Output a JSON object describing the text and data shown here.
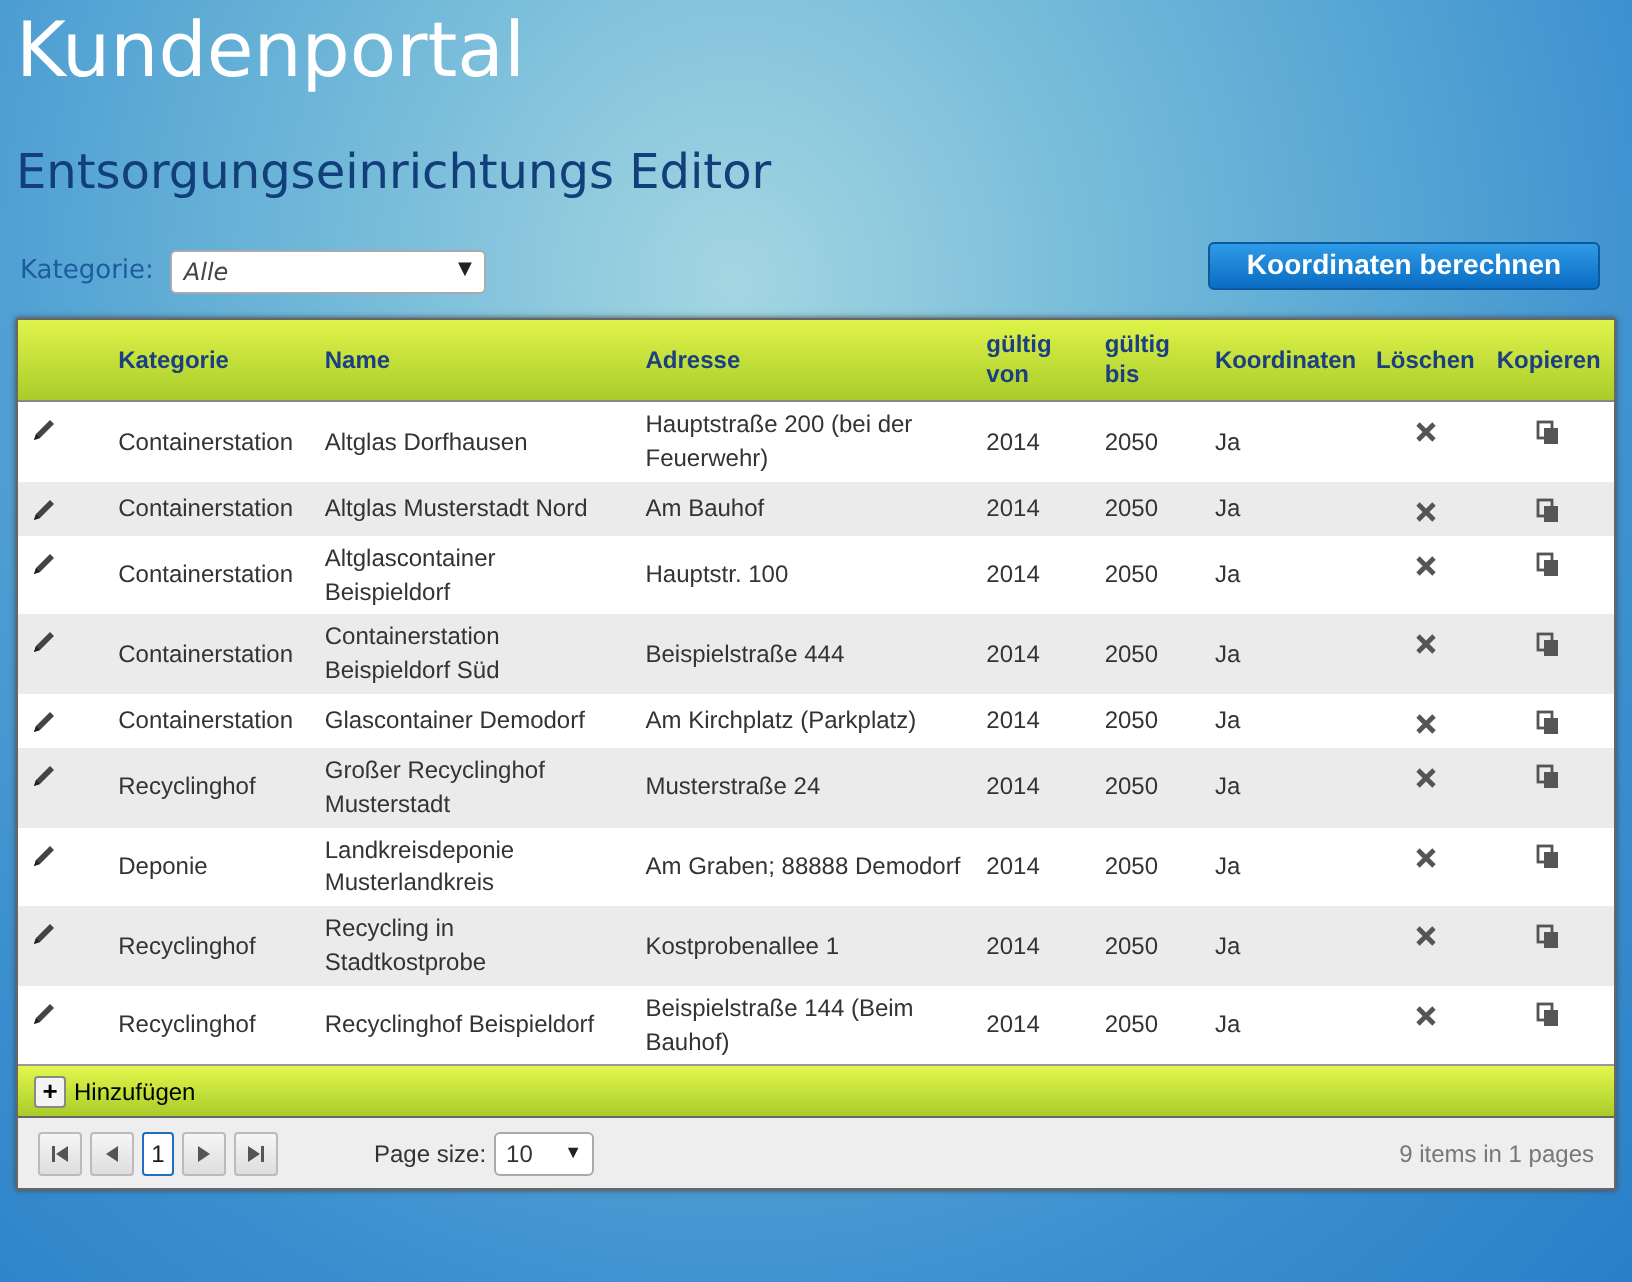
{
  "header": {
    "title": "Kundenportal",
    "subtitle": "Entsorgungseinrichtungs Editor"
  },
  "filter": {
    "label": "Kategorie:",
    "value": "Alle",
    "caret": "▼"
  },
  "action_button": "Koordinaten berechnen",
  "table": {
    "columns": [
      "Kategorie",
      "Name",
      "Adresse",
      "gültig von",
      "gültig bis",
      "Koordinaten",
      "Löschen",
      "Kopieren"
    ],
    "rows": [
      {
        "kategorie": "Containerstation",
        "name": "Altglas Dorfhausen",
        "adresse": "Hauptstraße 200 (bei der Feuerwehr)",
        "von": "2014",
        "bis": "2050",
        "koordinaten": "Ja"
      },
      {
        "kategorie": "Containerstation",
        "name": "Altglas Musterstadt Nord",
        "adresse": "Am Bauhof",
        "von": "2014",
        "bis": "2050",
        "koordinaten": "Ja"
      },
      {
        "kategorie": "Containerstation",
        "name": "Altglascontainer Beispieldorf",
        "adresse": "Hauptstr. 100",
        "von": "2014",
        "bis": "2050",
        "koordinaten": "Ja"
      },
      {
        "kategorie": "Containerstation",
        "name": "Containerstation Beispieldorf Süd",
        "adresse": "Beispielstraße 444",
        "von": "2014",
        "bis": "2050",
        "koordinaten": "Ja"
      },
      {
        "kategorie": "Containerstation",
        "name": "Glascontainer Demodorf",
        "adresse": "Am Kirchplatz (Parkplatz)",
        "von": "2014",
        "bis": "2050",
        "koordinaten": "Ja"
      },
      {
        "kategorie": "Recyclinghof",
        "name": "Großer Recyclinghof Musterstadt",
        "adresse": "Musterstraße 24",
        "von": "2014",
        "bis": "2050",
        "koordinaten": "Ja"
      },
      {
        "kategorie": "Deponie",
        "name": "Landkreisdeponie Musterlandkreis",
        "adresse": "Am Graben; 88888 Demodorf",
        "von": "2014",
        "bis": "2050",
        "koordinaten": "Ja"
      },
      {
        "kategorie": "Recyclinghof",
        "name": "Recycling in Stadtkostprobe",
        "adresse": "Kostprobenallee 1",
        "von": "2014",
        "bis": "2050",
        "koordinaten": "Ja"
      },
      {
        "kategorie": "Recyclinghof",
        "name": "Recyclinghof Beispieldorf",
        "adresse": "Beispielstraße 144 (Beim Bauhof)",
        "von": "2014",
        "bis": "2050",
        "koordinaten": "Ja"
      }
    ]
  },
  "add_button": {
    "icon": "+",
    "label": "Hinzufügen"
  },
  "pager": {
    "current_page": "1",
    "page_size_label": "Page size:",
    "page_size": "10",
    "page_size_caret": "▼",
    "summary": "9 items in 1 pages"
  }
}
